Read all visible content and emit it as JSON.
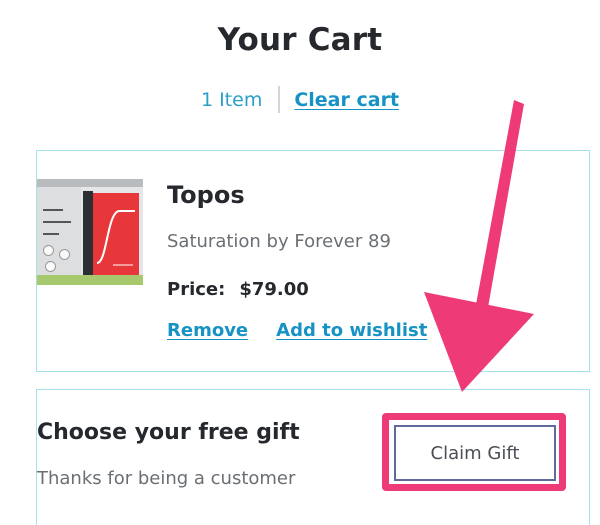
{
  "cart": {
    "title": "Your Cart",
    "item_count": "1 Item",
    "clear_cart": "Clear cart"
  },
  "product": {
    "name": "Topos",
    "subtitle": "Saturation by Forever 89",
    "price_label": "Price:",
    "price_value": "$79.00",
    "remove_label": "Remove",
    "wishlist_label": "Add to wishlist"
  },
  "gift": {
    "title": "Choose your free gift",
    "subtitle": "Thanks for being a customer",
    "claim_label": "Claim Gift"
  },
  "colors": {
    "link": "#1693c4",
    "card_border": "#a8e0ee",
    "annotation": "#ee3a77"
  }
}
